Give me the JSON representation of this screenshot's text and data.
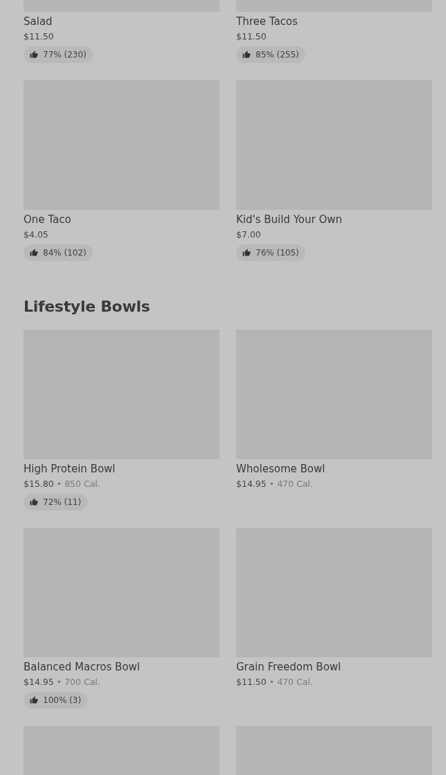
{
  "sections": [
    {
      "items": [
        {
          "kind": "dish",
          "name": "Salad",
          "price": "$11.50",
          "rating": "77% (230)"
        },
        {
          "kind": "dish",
          "name": "Three Tacos",
          "price": "$11.50",
          "rating": "85% (255)"
        },
        {
          "kind": "dish",
          "name": "One Taco",
          "price": "$4.05",
          "rating": "84% (102)"
        },
        {
          "kind": "dish",
          "name": "Kid's Build Your Own",
          "price": "$7.00",
          "rating": "76% (105)"
        }
      ]
    },
    {
      "title": "Lifestyle Bowls",
      "items": [
        {
          "kind": "dish",
          "name": "High Protein Bowl",
          "price": "$15.80",
          "separator": "•",
          "calories": "850 Cal.",
          "rating": "72% (11)"
        },
        {
          "kind": "dish",
          "name": "Wholesome Bowl",
          "price": "$14.95",
          "separator": "•",
          "calories": "470 Cal."
        },
        {
          "kind": "dish",
          "name": "Balanced Macros Bowl",
          "price": "$14.95",
          "separator": "•",
          "calories": "700 Cal.",
          "rating": "100% (3)"
        },
        {
          "kind": "dish",
          "name": "Grain Freedom Bowl",
          "price": "$11.50",
          "separator": "•",
          "calories": "470 Cal."
        },
        {
          "kind": "image"
        },
        {
          "kind": "image"
        }
      ]
    }
  ]
}
